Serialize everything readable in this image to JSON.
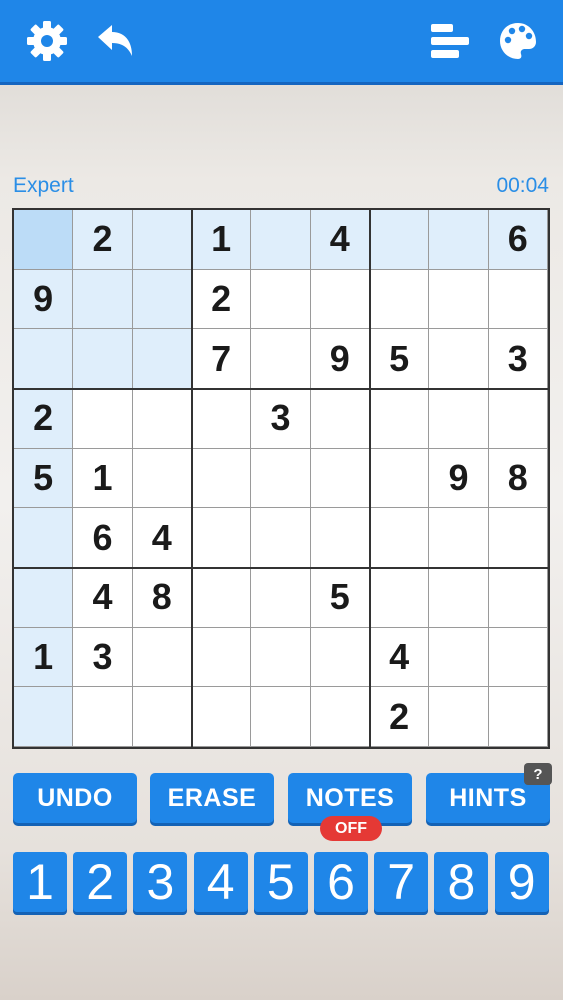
{
  "toolbar": {
    "icons": [
      "gear-icon",
      "undo-arrow-icon",
      "stats-bars-icon",
      "palette-icon"
    ],
    "accent": "#1f86e8"
  },
  "game": {
    "difficulty": "Expert",
    "timer": "00:04"
  },
  "board": {
    "rows": [
      [
        "",
        "2",
        "",
        "1",
        "",
        "4",
        "",
        "",
        "6"
      ],
      [
        "9",
        "",
        "",
        "2",
        "",
        "",
        "",
        "",
        ""
      ],
      [
        "",
        "",
        "",
        "7",
        "",
        "9",
        "5",
        "",
        "3"
      ],
      [
        "2",
        "",
        "",
        "",
        "3",
        "",
        "",
        "",
        ""
      ],
      [
        "5",
        "1",
        "",
        "",
        "",
        "",
        "",
        "9",
        "8"
      ],
      [
        "",
        "6",
        "4",
        "",
        "",
        "",
        "",
        "",
        ""
      ],
      [
        "",
        "4",
        "8",
        "",
        "",
        "5",
        "",
        "",
        ""
      ],
      [
        "1",
        "3",
        "",
        "",
        "",
        "",
        "4",
        "",
        ""
      ],
      [
        "",
        "",
        "",
        "",
        "",
        "",
        "2",
        "",
        ""
      ]
    ],
    "selected_cell": [
      0,
      0
    ],
    "highlight_color": "#dfeefb",
    "selected_color": "#bcdcf7"
  },
  "controls": {
    "undo": "UNDO",
    "erase": "ERASE",
    "notes": "NOTES",
    "notes_state": "OFF",
    "hints": "HINTS",
    "hints_badge": "?"
  },
  "numpad": [
    "1",
    "2",
    "3",
    "4",
    "5",
    "6",
    "7",
    "8",
    "9"
  ]
}
